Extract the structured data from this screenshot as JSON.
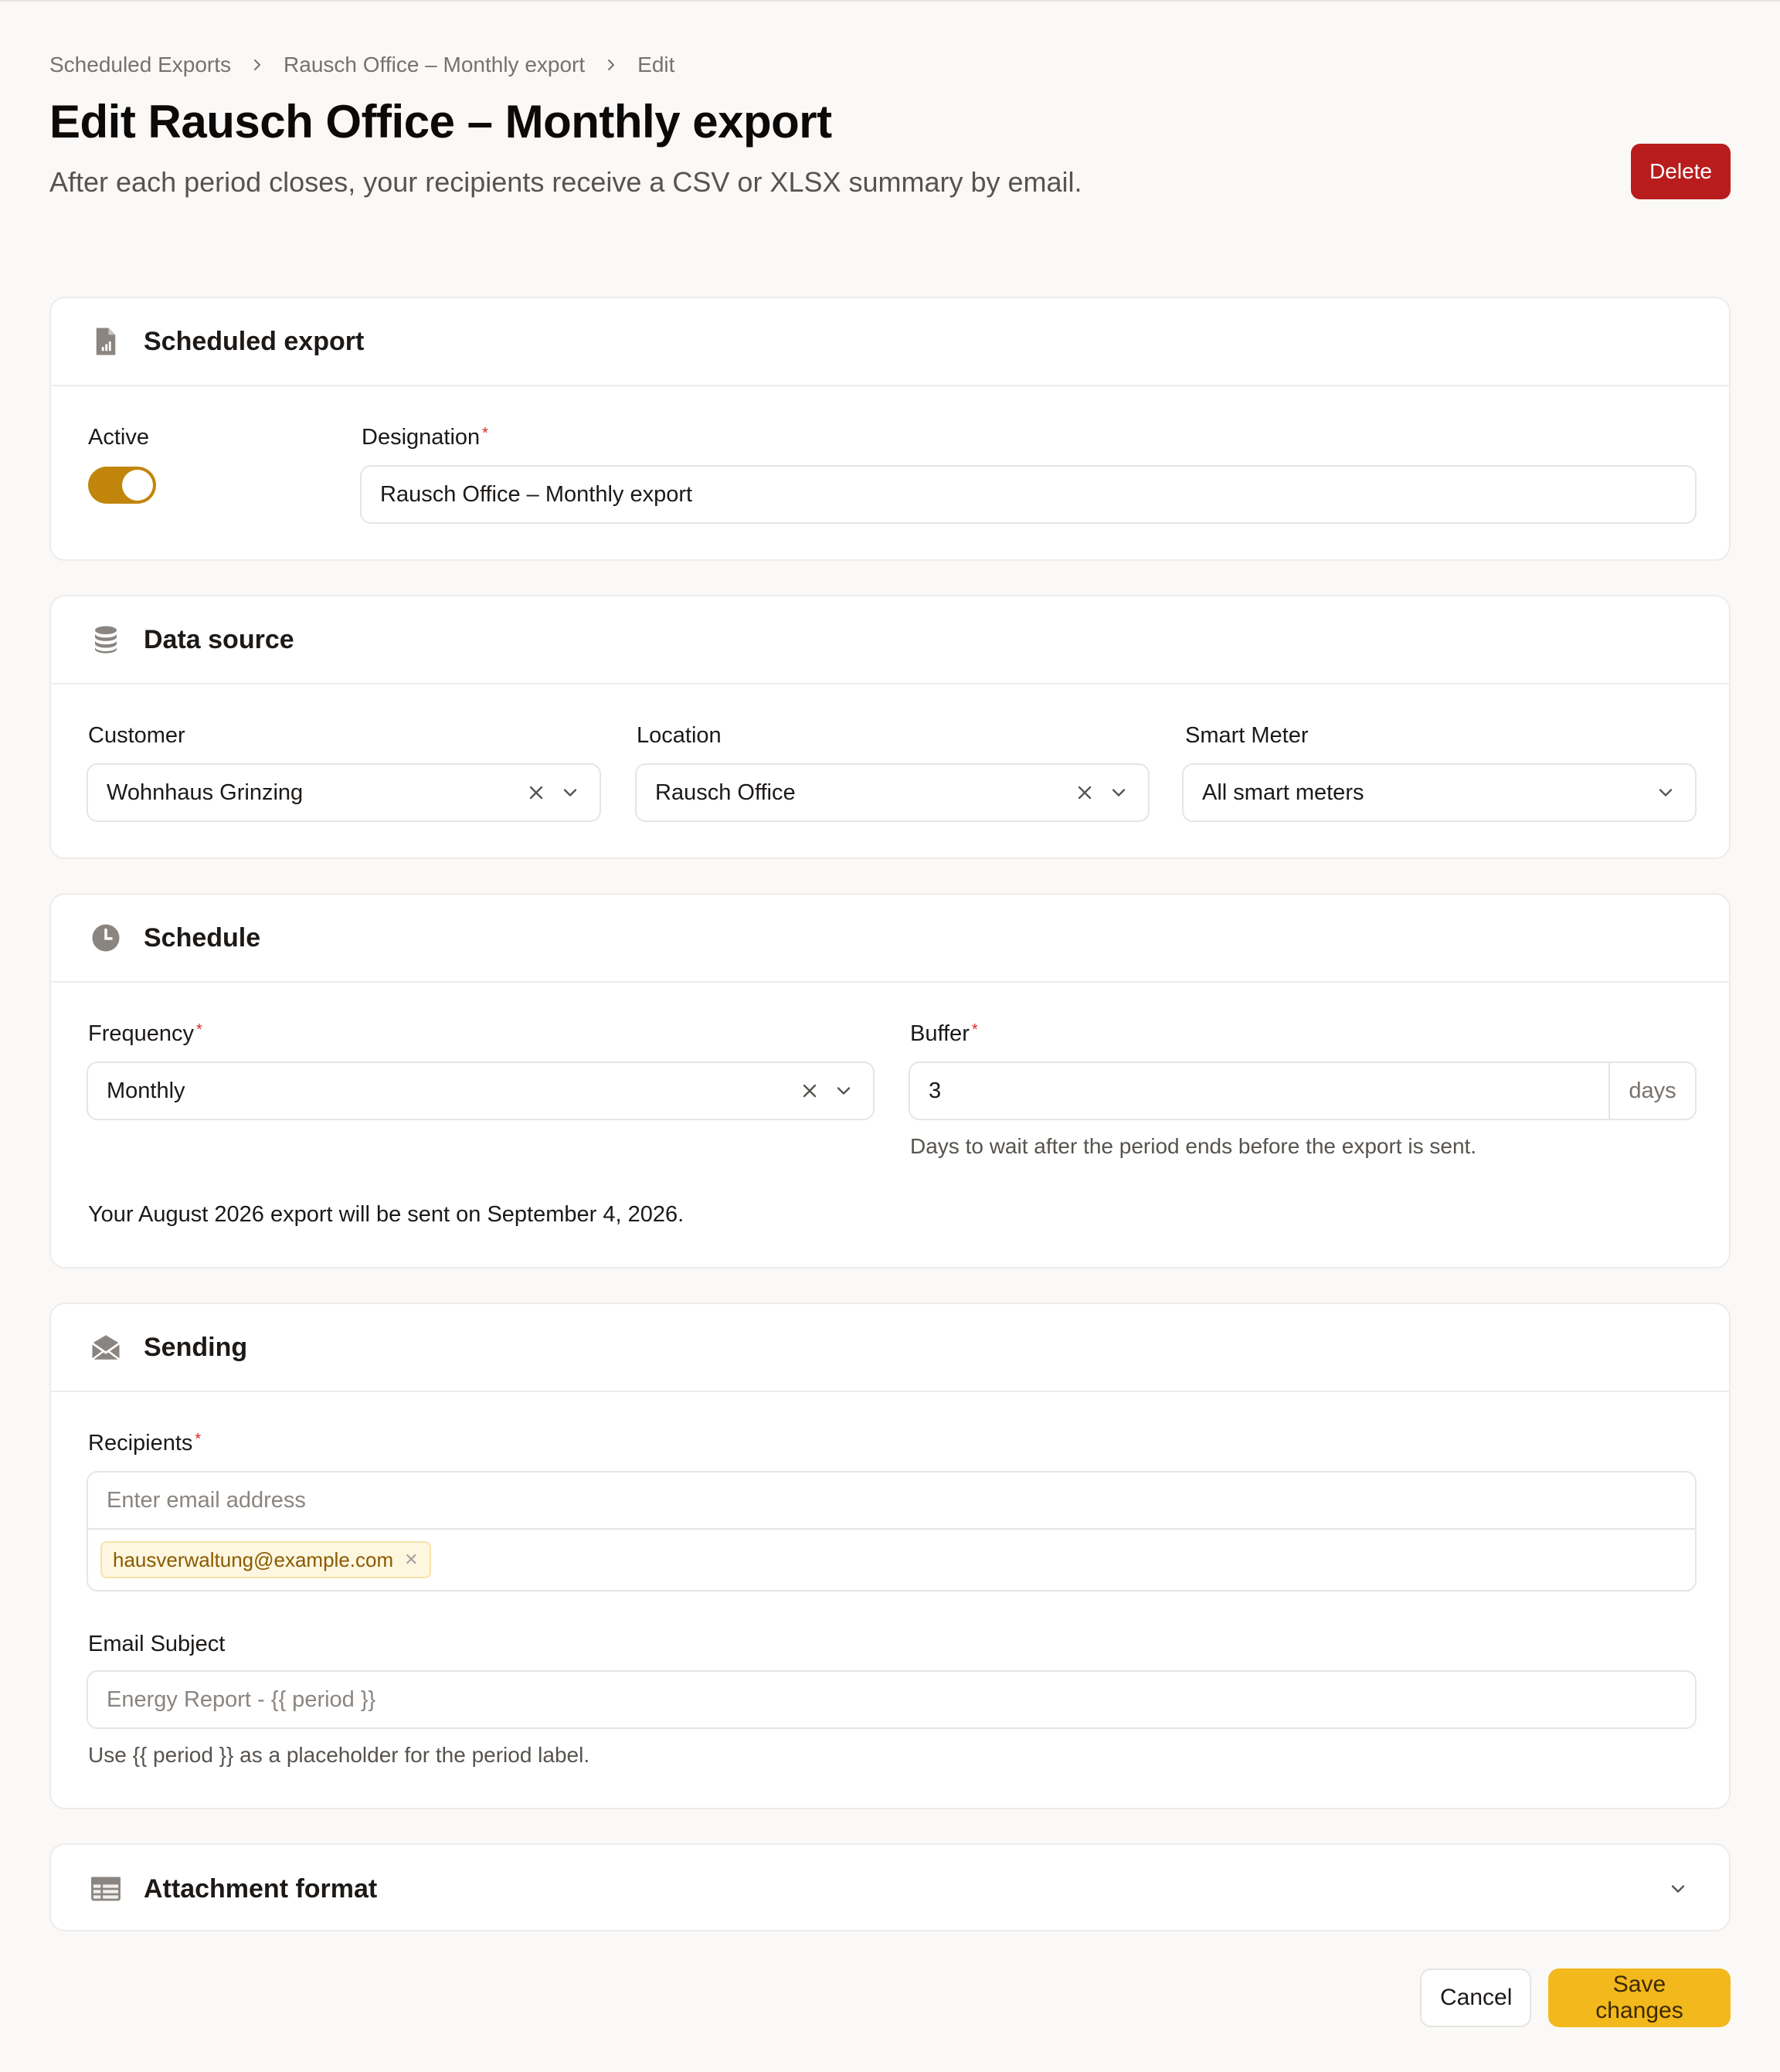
{
  "breadcrumb": [
    "Scheduled Exports",
    "Rausch Office – Monthly export",
    "Edit"
  ],
  "page": {
    "title": "Edit Rausch Office – Monthly export",
    "description": "After each period closes, your recipients receive a CSV or XLSX summary by email.",
    "delete_label": "Delete"
  },
  "scheduled_export": {
    "title": "Scheduled export",
    "icon": "file-chart-icon",
    "active_label": "Active",
    "active": true,
    "designation_label": "Designation",
    "designation_value": "Rausch Office – Monthly export"
  },
  "data_source": {
    "title": "Data source",
    "icon": "database-icon",
    "customer_label": "Customer",
    "customer_value": "Wohnhaus Grinzing",
    "location_label": "Location",
    "location_value": "Rausch Office",
    "meter_label": "Smart Meter",
    "meter_value": "All smart meters"
  },
  "schedule": {
    "title": "Schedule",
    "icon": "clock-icon",
    "frequency_label": "Frequency",
    "frequency_value": "Monthly",
    "buffer_label": "Buffer",
    "buffer_value": "3",
    "buffer_suffix": "days",
    "buffer_help": "Days to wait after the period ends before the export is sent.",
    "summary": "Your August 2026 export will be sent on September 4, 2026."
  },
  "sending": {
    "title": "Sending",
    "icon": "envelope-open-icon",
    "recipients_label": "Recipients",
    "recipients_placeholder": "Enter email address",
    "recipients": [
      "hausverwaltung@example.com"
    ],
    "subject_label": "Email Subject",
    "subject_placeholder": "Energy Report - {{ period }}",
    "subject_help": "Use {{ period }} as a placeholder for the period label."
  },
  "attachment": {
    "title": "Attachment format",
    "icon": "table-icon"
  },
  "footer": {
    "cancel_label": "Cancel",
    "save_label": "Save changes"
  },
  "colors": {
    "accent": "#f2b81c",
    "toggle_on": "#c2850c",
    "danger": "#b91c1c"
  }
}
